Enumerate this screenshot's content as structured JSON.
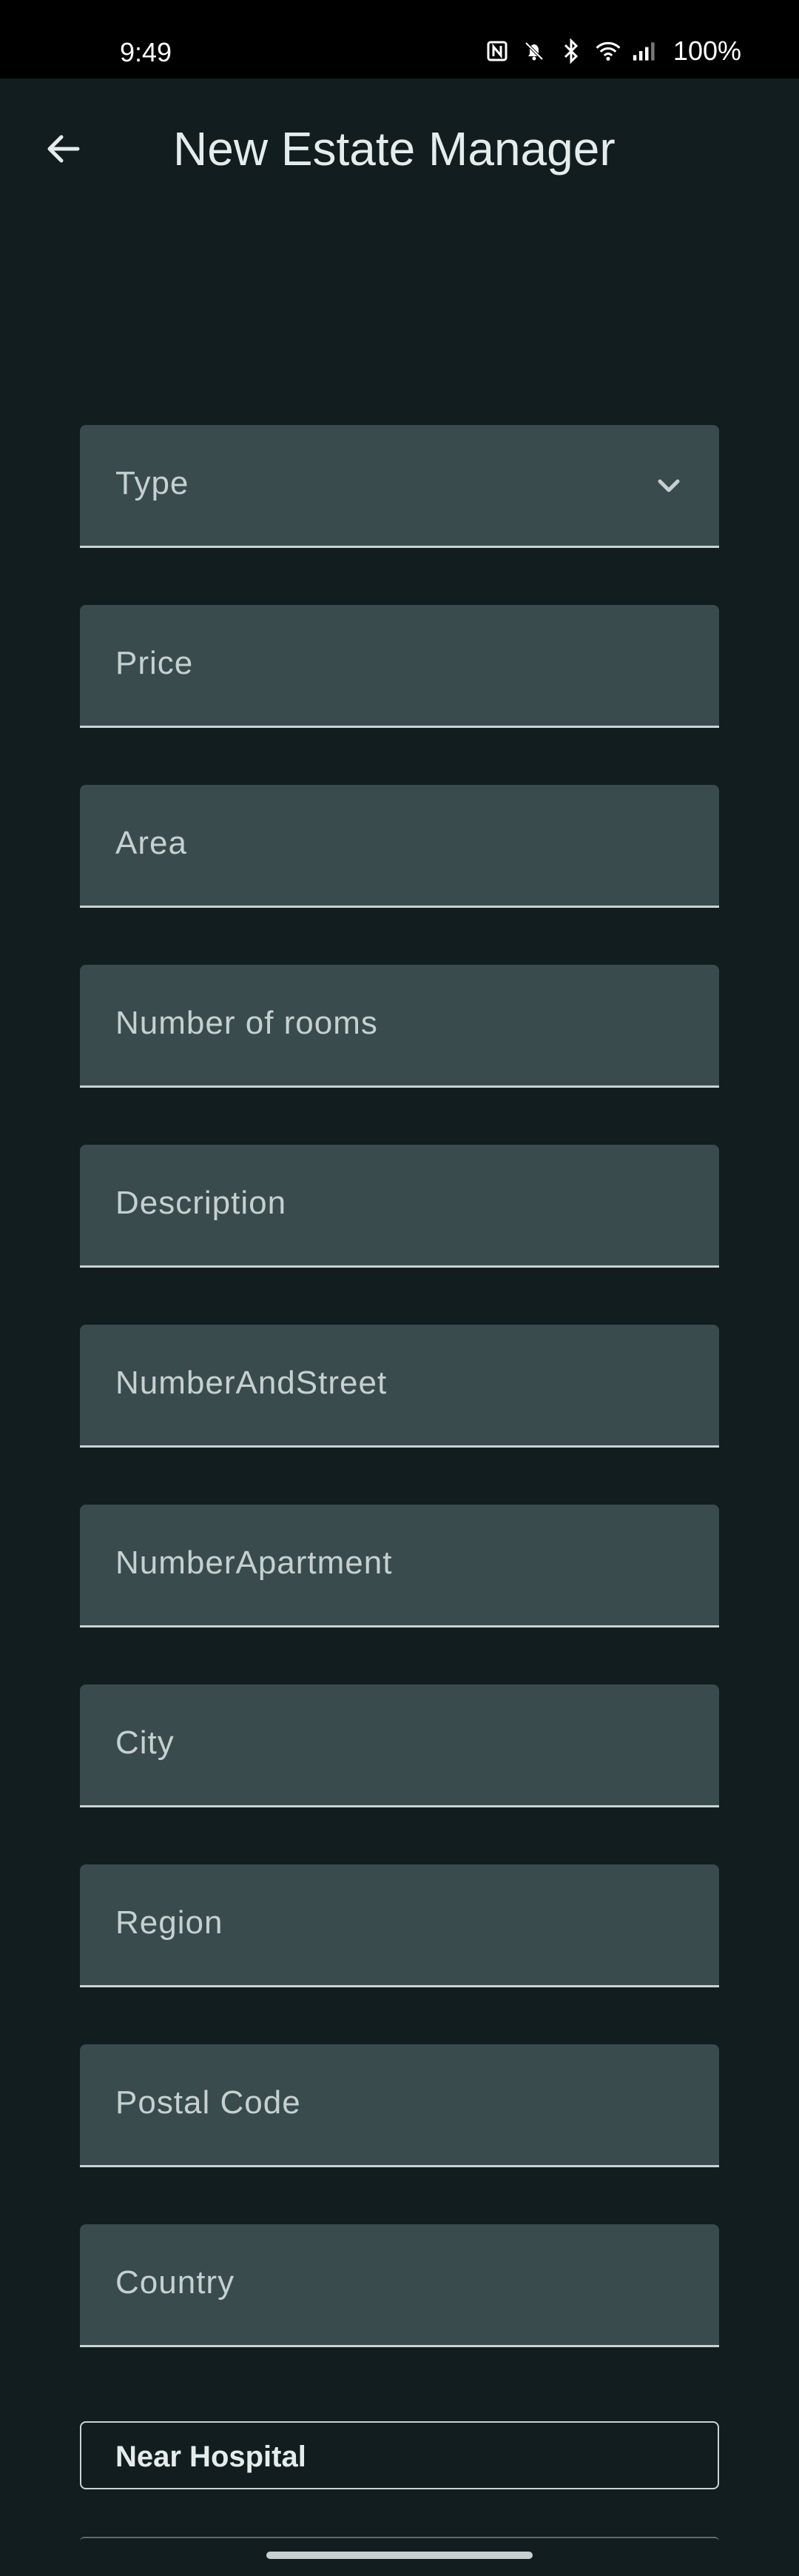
{
  "status_bar": {
    "time": "9:49",
    "battery": "100%",
    "icons": [
      "nfc-icon",
      "bell-off-icon",
      "bluetooth-icon",
      "wifi-icon",
      "signal-icon"
    ]
  },
  "app_bar": {
    "title": "New Estate Manager",
    "back_icon": "arrow-left-icon"
  },
  "form": {
    "type": {
      "label": "Type",
      "icon": "chevron-down-icon"
    },
    "fields": [
      {
        "label": "Price"
      },
      {
        "label": "Area"
      },
      {
        "label": "Number of rooms"
      },
      {
        "label": "Description"
      },
      {
        "label": "NumberAndStreet"
      },
      {
        "label": "NumberApartment"
      },
      {
        "label": "City"
      },
      {
        "label": "Region"
      },
      {
        "label": "Postal Code"
      },
      {
        "label": "Country"
      }
    ]
  },
  "chips": {
    "near_hospital": "Near Hospital"
  },
  "colors": {
    "background": "#121d1f",
    "field_fill": "#3a4b4d",
    "text": "#dfe6e6"
  }
}
